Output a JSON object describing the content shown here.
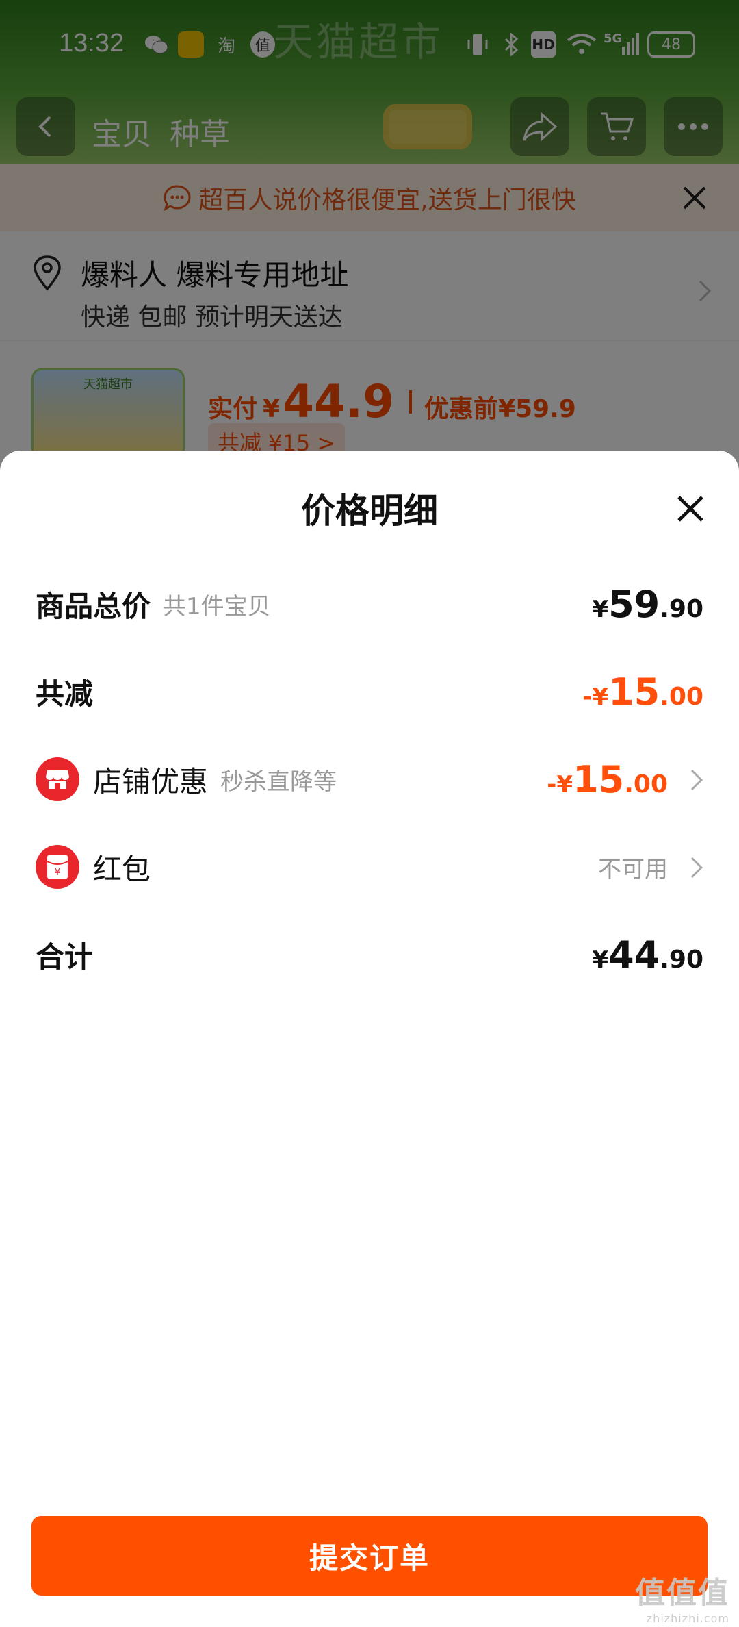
{
  "status_bar": {
    "time": "13:32",
    "network": "5G",
    "hd": "HD",
    "battery": "48"
  },
  "background": {
    "hero_title": "天猫超市",
    "tabs": [
      "宝贝",
      "种草"
    ],
    "banner_text": "超百人说价格很便宜,送货上门很快",
    "address": {
      "name": "爆料人 爆料专用地址",
      "sub": "快递 包邮 预计明天送达"
    },
    "product": {
      "pay_label": "实付",
      "pay_currency": "¥",
      "pay_amount": "44.9",
      "before_label": "优惠前",
      "before_amount": "¥59.9",
      "tag": "共减 ¥15 >",
      "image_label": "天猫超市"
    }
  },
  "sheet": {
    "title": "价格明细",
    "rows": [
      {
        "label": "商品总价",
        "sub": "共1件宝贝",
        "prefix": "",
        "currency": "¥",
        "int": "59",
        "dec": ".90"
      },
      {
        "label": "共减",
        "sub": "",
        "prefix": "-",
        "currency": "¥",
        "int": "15",
        "dec": ".00"
      },
      {
        "label": "店铺优惠",
        "sub": "秒杀直降等",
        "prefix": "-",
        "currency": "¥",
        "int": "15",
        "dec": ".00"
      },
      {
        "label": "红包",
        "sub": "",
        "status": "不可用"
      },
      {
        "label": "合计",
        "sub": "",
        "prefix": "",
        "currency": "¥",
        "int": "44",
        "dec": ".90"
      }
    ],
    "redpacket_icon_char": "¥",
    "submit_label": "提交订单"
  },
  "watermark": {
    "logo": "值值值",
    "url": "zhizhizhi.com"
  },
  "colors": {
    "accent": "#ff5000",
    "discount": "#ff4f0a",
    "icon_red": "#e8262c"
  },
  "icons": [
    "back-icon",
    "share-icon",
    "cart-icon",
    "more-icon",
    "chat-icon",
    "close-icon",
    "location-pin-icon",
    "chevron-right-icon",
    "store-icon",
    "red-packet-icon"
  ]
}
